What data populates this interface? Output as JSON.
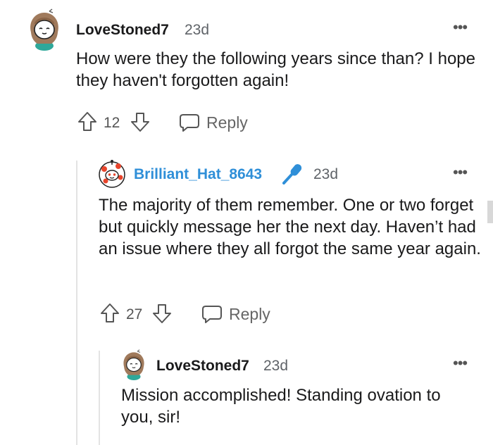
{
  "comments": [
    {
      "username": "LoveStoned7",
      "age": "23d",
      "text": "How were they the following years since than? I hope they haven't forgotten again!",
      "votes": "12",
      "reply_label": "Reply",
      "more_icon": "more-dots-icon",
      "avatar_icon": "snoo-avatar-brown-hair"
    },
    {
      "username": "Brilliant_Hat_8643",
      "age": "23d",
      "flair_icon": "microphone-icon",
      "text": "The majority of them remember. One or two forget but quickly message her the next day. Haven’t had an issue where they all forgot the same year again.",
      "votes": "27",
      "reply_label": "Reply",
      "more_icon": "more-dots-icon",
      "avatar_icon": "snoo-avatar-red-white"
    },
    {
      "username": "LoveStoned7",
      "age": "23d",
      "text": "Mission accomplished! Standing ovation to you, sir!",
      "more_icon": "more-dots-icon",
      "avatar_icon": "snoo-avatar-brown-hair"
    }
  ],
  "colors": {
    "username_highlight": "#2f8fd8",
    "text": "#1a1a1b",
    "muted": "#5f6368",
    "thread_line": "#e3e3e3"
  }
}
